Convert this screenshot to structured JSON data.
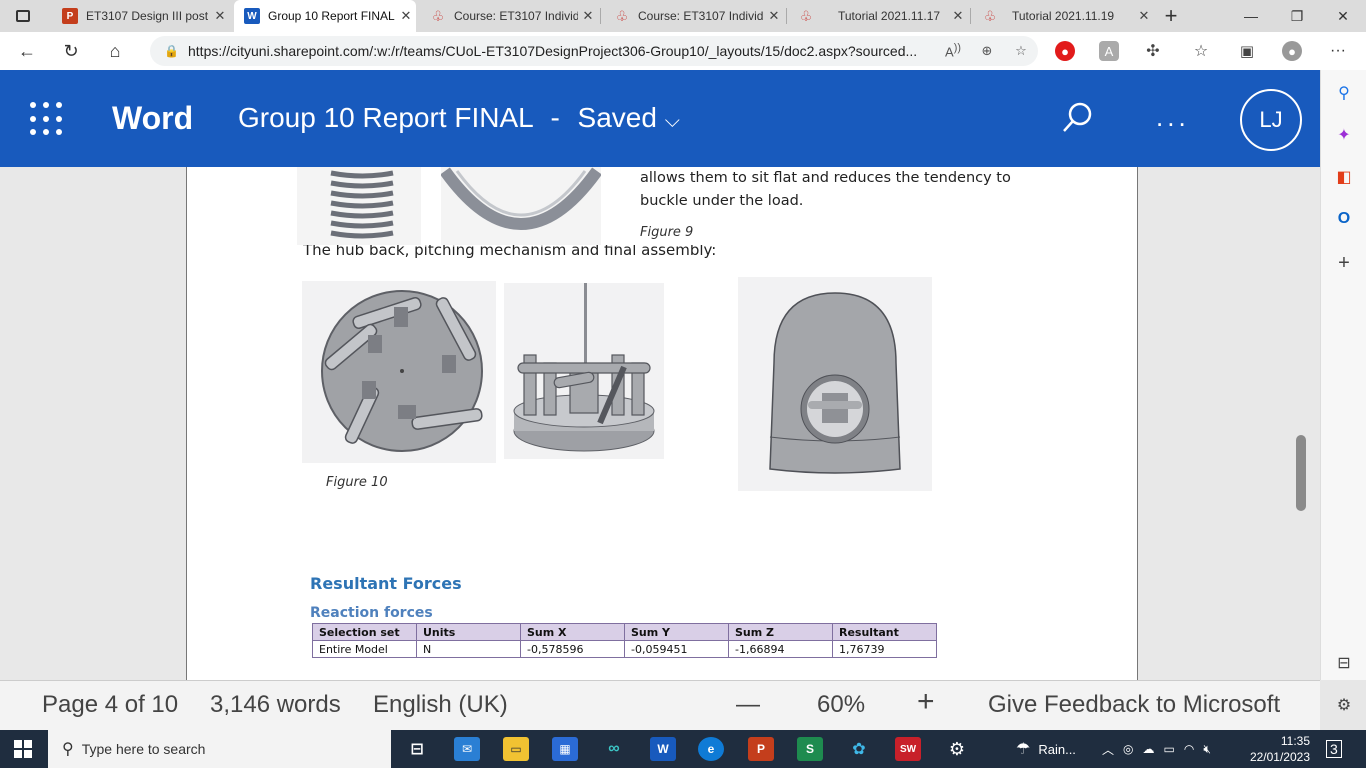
{
  "browser": {
    "tabs": [
      {
        "title": "ET3107 Design III post",
        "icon": "powerpoint-icon"
      },
      {
        "title": "Group 10 Report FINAL",
        "icon": "word-icon"
      },
      {
        "title": "Course: ET3107 Individ",
        "icon": "moodle-icon"
      },
      {
        "title": "Course: ET3107 Individ",
        "icon": "moodle-icon"
      },
      {
        "title": "Tutorial 2021.11.17",
        "icon": "moodle-icon"
      },
      {
        "title": "Tutorial 2021.11.19",
        "icon": "moodle-icon"
      }
    ],
    "new_tab": "+",
    "url": "https://cityuni.sharepoint.com/:w:/r/teams/CUoL-ET3107DesignProject306-Group10/_layouts/15/doc2.aspx?sourced..."
  },
  "word": {
    "app_name": "Word",
    "doc_title": "Group 10 Report FINAL",
    "status": "Saved",
    "title_sep": "-",
    "user_initials": "LJ",
    "more": "..."
  },
  "doc": {
    "para1_line1": "allows them to sit flat and reduces the tendency to",
    "para1_line2": "buckle under the load.",
    "fig9_caption": "Figure 9",
    "hub_text": "The hub back, pitching mechanism and final assembly:",
    "fig10_caption": "Figure 10",
    "heading_resultant": "Resultant Forces",
    "heading_reaction": "Reaction forces",
    "table_headers": [
      "Selection set",
      "Units",
      "Sum X",
      "Sum Y",
      "Sum Z",
      "Resultant"
    ],
    "table_row": [
      "Entire Model",
      "N",
      "-0,578596",
      "-0,059451",
      "-1,66894",
      "1,76739"
    ]
  },
  "statusbar": {
    "page": "Page 4 of 10",
    "words": "3,146 words",
    "language": "English (UK)",
    "zoom_out": "—",
    "zoom": "60%",
    "zoom_in": "+",
    "feedback": "Give Feedback to Microsoft"
  },
  "taskbar": {
    "search_placeholder": "Type here to search",
    "weather": "Rain...",
    "time": "11:35",
    "date": "22/01/2023",
    "notifications": "3"
  },
  "colors": {
    "word_blue": "#185abd",
    "heading_blue": "#2e74b5",
    "table_header": "#d9cfe7",
    "taskbar": "#1f2d3f"
  }
}
